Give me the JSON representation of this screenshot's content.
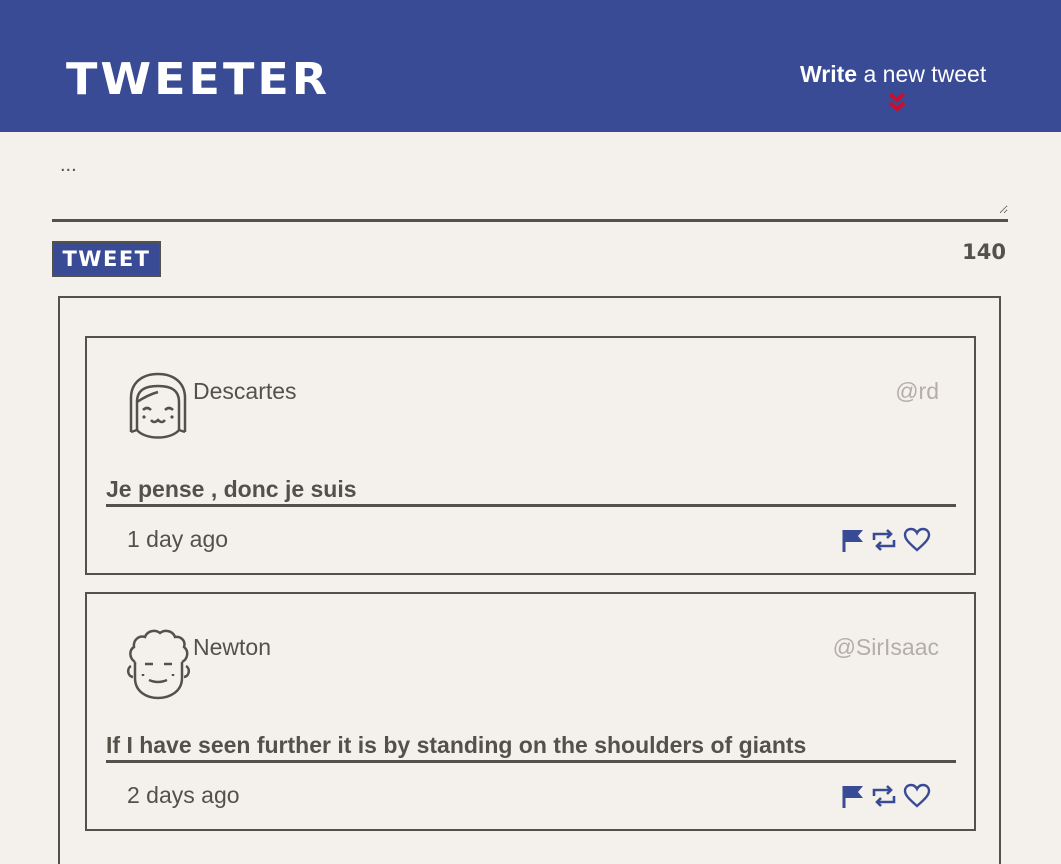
{
  "header": {
    "logo": "TWEETER",
    "write_bold": "Write",
    "write_rest": " a new tweet"
  },
  "composer": {
    "placeholder": "...",
    "submit_label": "TWEET",
    "counter": "140"
  },
  "tweets": [
    {
      "name": "Descartes",
      "handle": "@rd",
      "content": "Je pense , donc je suis",
      "age": "1 day ago"
    },
    {
      "name": "Newton",
      "handle": "@SirIsaac",
      "content": "If I have seen further it is by standing on the shoulders of giants",
      "age": "2 days ago"
    }
  ],
  "icons": {
    "accent": "#3a4b95",
    "chevron": "#c8102e",
    "actions": [
      "flag-icon",
      "retweet-icon",
      "heart-icon"
    ]
  }
}
